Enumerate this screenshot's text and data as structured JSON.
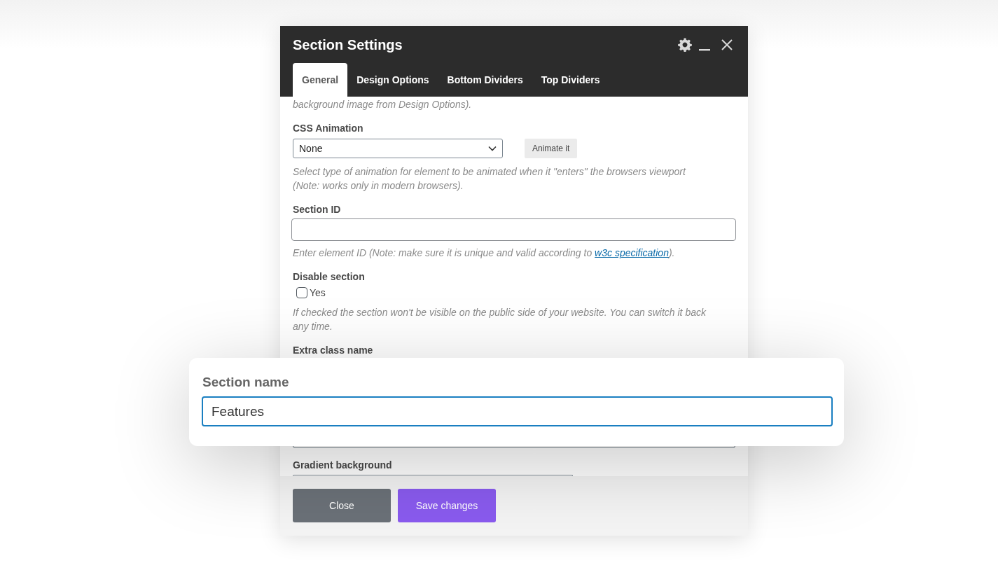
{
  "dialog": {
    "title": "Section Settings",
    "tabs": [
      {
        "label": "General",
        "selected": true
      },
      {
        "label": "Design Options",
        "selected": false
      },
      {
        "label": "Bottom Dividers",
        "selected": false
      },
      {
        "label": "Top Dividers",
        "selected": false
      }
    ],
    "fields": [
      {
        "kind": "note",
        "help": "background image from Design Options)."
      },
      {
        "kind": "select",
        "label": "CSS Animation",
        "value": "None",
        "button": "Animate it",
        "help": "Select type of animation for element to be animated when it \"enters\" the browsers viewport (Note: works only in modern browsers)."
      },
      {
        "kind": "text",
        "label": "Section ID",
        "help_before": "Enter element ID (Note: make sure it is unique and valid according to ",
        "link": "w3c specification",
        "help_after": ")."
      },
      {
        "kind": "checkbox",
        "label": "Disable section",
        "option": "Yes",
        "checked": false,
        "help": "If checked the section won't be visible on the public side of your website. You can switch it back any time."
      },
      {
        "kind": "heading",
        "label": "Extra class name"
      },
      {
        "kind": "edge"
      },
      {
        "kind": "dropdown",
        "label": "Gradient background"
      }
    ],
    "buttons": [
      {
        "label": "Close",
        "kind": "secondary"
      },
      {
        "label": "Save changes",
        "kind": "primary"
      }
    ]
  },
  "highlight": {
    "label": "Section name",
    "value": "Features"
  }
}
